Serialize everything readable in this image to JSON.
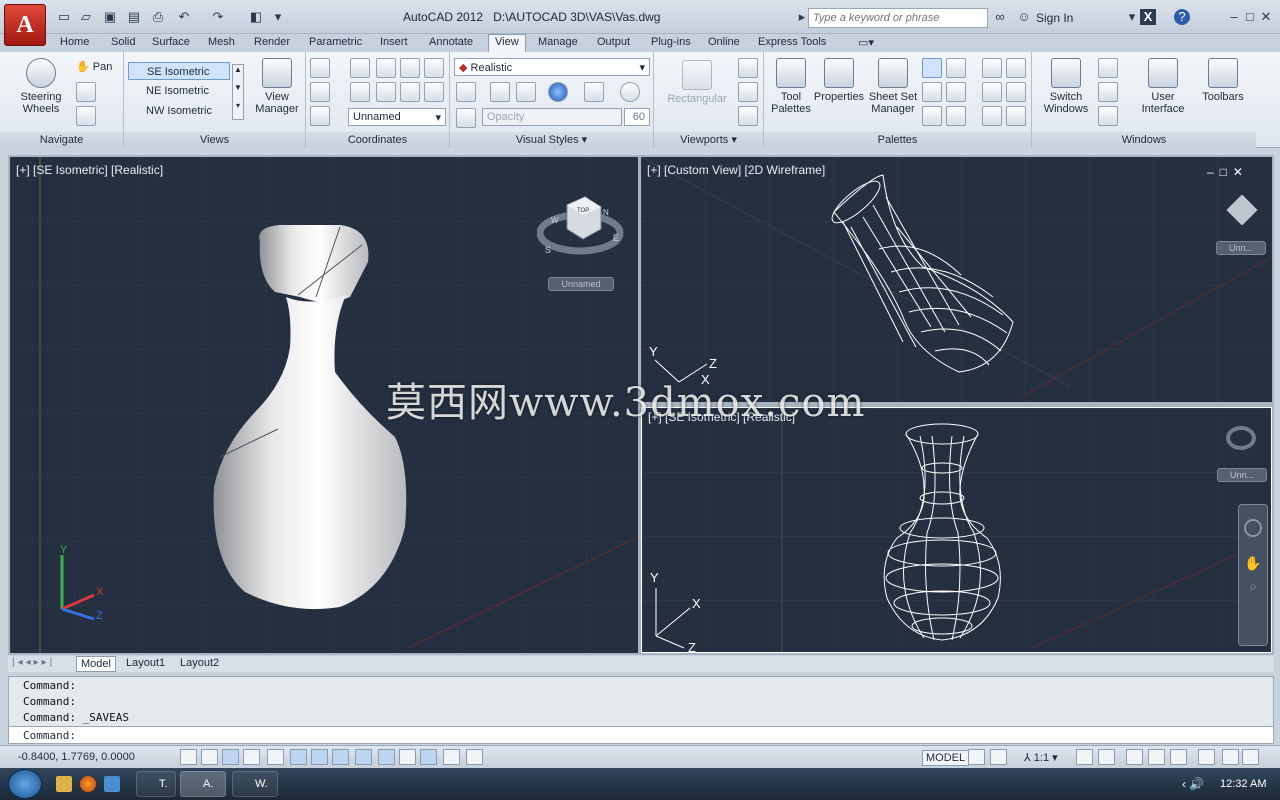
{
  "title": {
    "app": "AutoCAD 2012",
    "file": "D:\\AUTOCAD 3D\\VAS\\Vas.dwg",
    "search_placeholder": "Type a keyword or phrase",
    "sign_in": "Sign In"
  },
  "tabs": [
    "Home",
    "Solid",
    "Surface",
    "Mesh",
    "Render",
    "Parametric",
    "Insert",
    "Annotate",
    "View",
    "Manage",
    "Output",
    "Plug-ins",
    "Online",
    "Express Tools"
  ],
  "active_tab": "View",
  "ribbon": {
    "navigate": {
      "label": "Navigate",
      "steering": "Steering Wheels",
      "pan": "Pan"
    },
    "views": {
      "label": "Views",
      "items": [
        "SE Isometric",
        "NE Isometric",
        "NW Isometric"
      ],
      "manager": "View Manager"
    },
    "coordinates": {
      "label": "Coordinates",
      "ucs": "Unnamed"
    },
    "visual_styles": {
      "label": "Visual Styles",
      "style": "Realistic",
      "opacity": "Opacity",
      "opacity_value": "60"
    },
    "viewports": {
      "label": "Viewports",
      "rect": "Rectangular"
    },
    "palettes": {
      "label": "Palettes",
      "tool": "Tool Palettes",
      "props": "Properties",
      "sheetset": "Sheet Set Manager"
    },
    "windows": {
      "label": "Windows",
      "switch": "Switch Windows",
      "ui": "User Interface",
      "toolbars": "Toolbars"
    }
  },
  "viewports": {
    "left": {
      "label": "[+] [SE Isometric] [Realistic]",
      "ucs": "Unnamed"
    },
    "top_right": {
      "label": "[+] [Custom View] [2D Wireframe]",
      "ucs": "Unn..."
    },
    "bottom_right": {
      "label": "[+] [SE Isometric] [Realistic]",
      "ucs": "Unn..."
    },
    "axes": {
      "x": "X",
      "y": "Y",
      "z": "Z"
    },
    "viewcube": {
      "face": "TOP",
      "n": "N",
      "s": "S",
      "e": "E",
      "w": "W"
    }
  },
  "layout_tabs": [
    "Model",
    "Layout1",
    "Layout2"
  ],
  "command": {
    "history": [
      "Command:",
      "Command:",
      "Command: _SAVEAS"
    ],
    "prompt": "Command:"
  },
  "status": {
    "coords": "-0.8400, 1.7769, 0.0000",
    "model": "MODEL",
    "scale": "1:1"
  },
  "taskbar": {
    "items": [
      "T.",
      "A.",
      "W."
    ],
    "clock": "12:32 AM"
  },
  "watermark": "莫西网www.3dmox.com"
}
